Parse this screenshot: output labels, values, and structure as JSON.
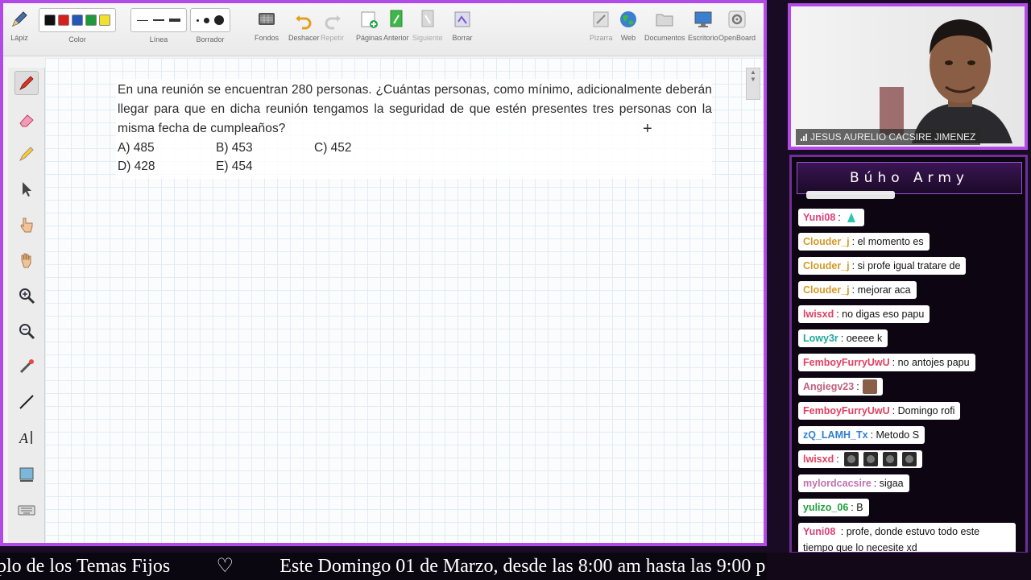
{
  "toolbar": {
    "tools": [
      {
        "label": "Lápiz",
        "icon": "pen-icon"
      },
      {
        "label": "Color",
        "icon": "color-palette"
      },
      {
        "label": "Línea",
        "icon": "line-width"
      },
      {
        "label": "Borrador",
        "icon": "eraser-size"
      },
      {
        "label": "Fondos",
        "icon": "backgrounds-icon"
      },
      {
        "label": "Deshacer",
        "icon": "undo-icon"
      },
      {
        "label": "Repetir",
        "icon": "redo-icon"
      },
      {
        "label": "Páginas",
        "icon": "pages-icon"
      },
      {
        "label": "Anterior",
        "icon": "previous-page-icon"
      },
      {
        "label": "Siguiente",
        "icon": "next-page-icon"
      },
      {
        "label": "Borrar",
        "icon": "clear-icon"
      },
      {
        "label": "Pizarra",
        "icon": "board-icon"
      },
      {
        "label": "Web",
        "icon": "globe-icon"
      },
      {
        "label": "Documentos",
        "icon": "folder-icon"
      },
      {
        "label": "Escritorio",
        "icon": "desktop-icon"
      },
      {
        "label": "OpenBoard",
        "icon": "settings-icon"
      }
    ],
    "colors": [
      "#111111",
      "#d81e1e",
      "#2457b8",
      "#1f9a3a",
      "#f3e02a"
    ]
  },
  "problem": {
    "text": "En una reunión se encuentran 280 personas. ¿Cuántas personas, como mínimo, adicionalmente deberán llegar para que en dicha reunión tengamos la seguridad de que estén presentes tres personas con la misma fecha de cumpleaños?",
    "options": [
      "A) 485",
      "B) 453",
      "C) 452",
      "D) 428",
      "E) 454"
    ]
  },
  "webcam": {
    "name": "JESUS AURELIO CACSIRE JIMENEZ"
  },
  "chat": {
    "title": "Búho Army",
    "messages": [
      {
        "user": "Yuni08",
        "user_color": "#e0407a",
        "text": ":",
        "extra": "sticker"
      },
      {
        "user": "Clouder_j",
        "user_color": "#d49a2a",
        "text": ": el momento es"
      },
      {
        "user": "Clouder_j",
        "user_color": "#d49a2a",
        "text": ": si profe igual tratare de"
      },
      {
        "user": "Clouder_j",
        "user_color": "#d49a2a",
        "text": ": mejorar aca"
      },
      {
        "user": "lwisxd",
        "user_color": "#e04060",
        "text": ": no digas eso papu"
      },
      {
        "user": "Lowy3r",
        "user_color": "#1fa89a",
        "text": ": oeeee k"
      },
      {
        "user": "FemboyFurryUwU",
        "user_color": "#e04060",
        "text": ": no antojes papu"
      },
      {
        "user": "Angiegv23",
        "user_color": "#c06080",
        "text": ":",
        "extra": "photo"
      },
      {
        "user": "FemboyFurryUwU",
        "user_color": "#e04060",
        "text": ": Domingo rofi"
      },
      {
        "user": "zQ_LAMH_Tx",
        "user_color": "#2f7fd0",
        "text": ": Metodo S"
      },
      {
        "user": "lwisxd",
        "user_color": "#e04060",
        "text": ":",
        "extra": "emotes"
      },
      {
        "user": "mylordcacsire",
        "user_color": "#c070b0",
        "text": ": sigaa"
      },
      {
        "user": "yulizo_06",
        "user_color": "#22a040",
        "text": ": B"
      },
      {
        "user": "Yuni08",
        "user_color": "#e0407a",
        "text": ": profe, donde estuvo todo este tiempo que lo necesite xd"
      }
    ]
  },
  "ticker": {
    "left_text": "plo de los Temas Fijos",
    "heart": "♡",
    "right_text": "Este Domingo 01 de Marzo, desde las 8:00 am hasta las 9:00 p"
  }
}
